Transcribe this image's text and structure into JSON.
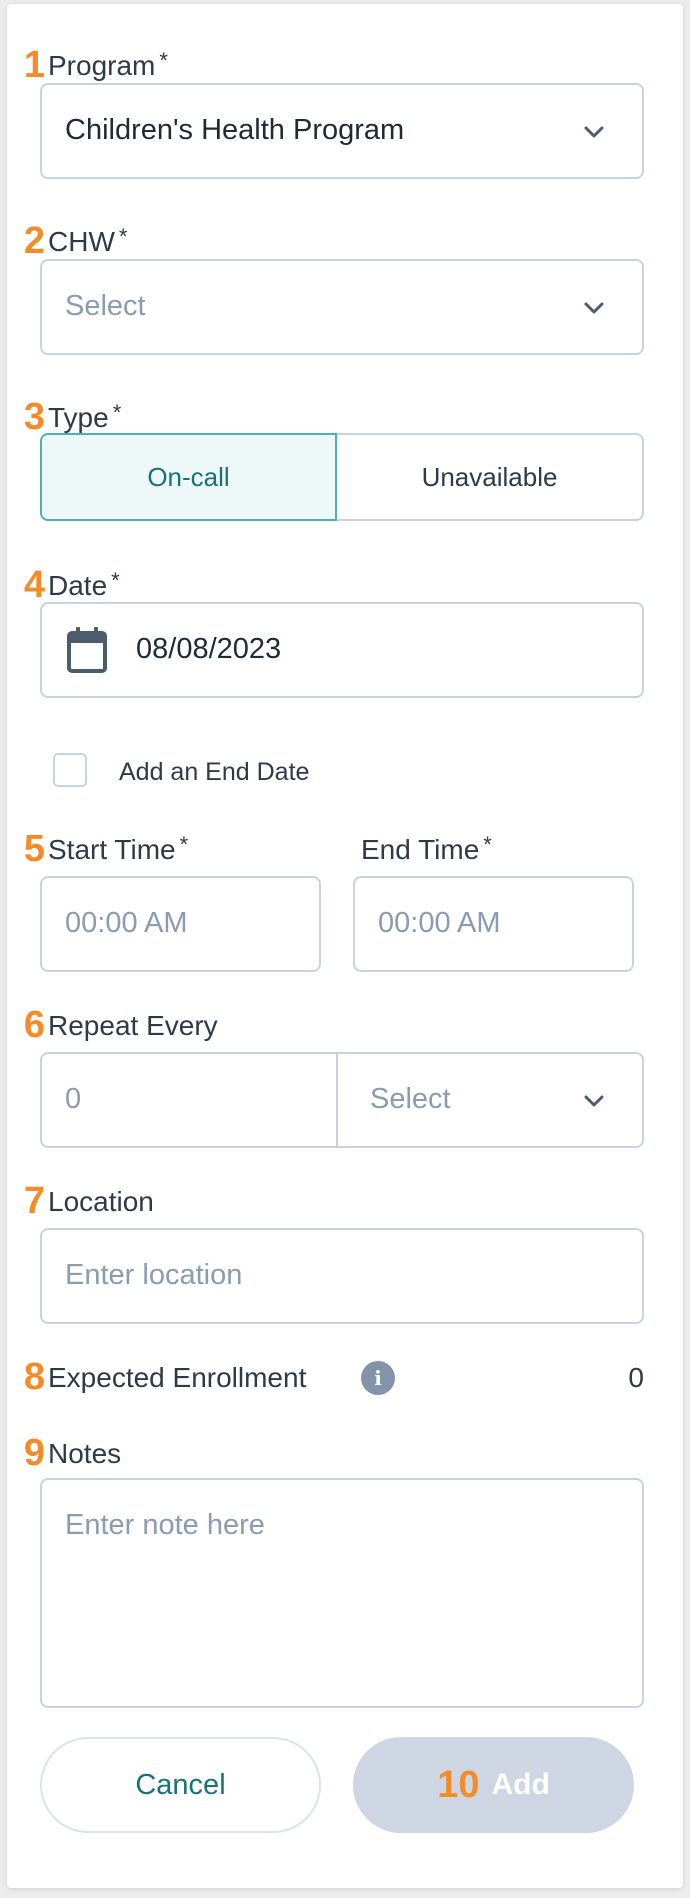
{
  "form": {
    "program": {
      "step": "1",
      "label": "Program",
      "required_mark": "*",
      "value": "Children's Health Program",
      "icon": "chevron-down-icon"
    },
    "chw": {
      "step": "2",
      "label": "CHW",
      "required_mark": "*",
      "placeholder": "Select",
      "icon": "chevron-down-icon"
    },
    "type": {
      "step": "3",
      "label": "Type",
      "required_mark": "*",
      "options": [
        "On-call",
        "Unavailable"
      ],
      "selected": "On-call"
    },
    "date": {
      "step": "4",
      "label": "Date",
      "required_mark": "*",
      "value": "08/08/2023",
      "icon": "calendar-icon"
    },
    "end_date_checkbox": {
      "label": "Add an End Date",
      "checked": false
    },
    "time": {
      "step": "5",
      "start_label": "Start Time",
      "start_required_mark": "*",
      "start_placeholder": "00:00 AM",
      "end_label": "End Time",
      "end_required_mark": "*",
      "end_placeholder": "00:00 AM"
    },
    "repeat": {
      "step": "6",
      "label": "Repeat Every",
      "number_placeholder": "0",
      "unit_placeholder": "Select",
      "icon": "chevron-down-icon"
    },
    "location": {
      "step": "7",
      "label": "Location",
      "placeholder": "Enter location"
    },
    "enrollment": {
      "step": "8",
      "label": "Expected Enrollment",
      "info_icon": "info-icon",
      "info_glyph": "i",
      "value": "0"
    },
    "notes": {
      "step": "9",
      "label": "Notes",
      "placeholder": "Enter note here"
    }
  },
  "actions": {
    "cancel_label": "Cancel",
    "add_step": "10",
    "add_label": "Add"
  },
  "colors": {
    "accent_orange": "#f28c2a",
    "teal_text": "#17737a",
    "teal_border": "#4bb0b3",
    "disabled_button": "#cdd6e2",
    "border": "#c9d3df",
    "placeholder": "#8b9bb0"
  }
}
